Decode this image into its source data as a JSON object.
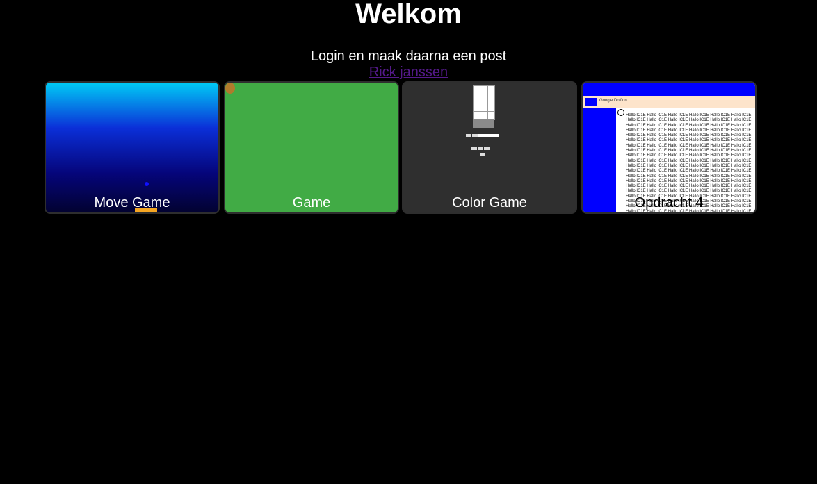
{
  "header": {
    "title": "Welkom",
    "subtitle": "Login en maak daarna een post",
    "author_link": "Rick janssen"
  },
  "cards": [
    {
      "label": "Move Game"
    },
    {
      "label": "Game"
    },
    {
      "label": "Color Game"
    },
    {
      "label": "Opdracht 4",
      "thumb_band": "Google Dolfion",
      "thumb_text": "Hallo IC1E Hallo IC1E Hallo IC1E Hallo IC1E Hallo IC1E Hallo IC1E Hallo IC1E Hallo IC1E Hallo IC1E Hallo IC1E Hallo IC1E Hallo IC1E Hallo IC1E Hallo IC1E Hallo IC1E Hallo IC1E Hallo IC1E Hallo IC1E Hallo IC1E Hallo IC1E Hallo IC1E Hallo IC1E Hallo IC1E Hallo IC1E Hallo IC1E Hallo IC1E Hallo IC1E Hallo IC1E Hallo IC1E Hallo IC1E Hallo IC1E Hallo IC1E Hallo IC1E Hallo IC1E Hallo IC1E Hallo IC1E Hallo IC1E Hallo IC1E Hallo IC1E Hallo IC1E Hallo IC1E Hallo IC1E Hallo IC1E Hallo IC1E Hallo IC1E Hallo IC1E Hallo IC1E Hallo IC1E Hallo IC1E Hallo IC1E Hallo IC1E Hallo IC1E Hallo IC1E Hallo IC1E Hallo IC1E Hallo IC1E Hallo IC1E Hallo IC1E Hallo IC1E Hallo IC1E Hallo IC1E Hallo IC1E Hallo IC1E Hallo IC1E Hallo IC1E Hallo IC1E Hallo IC1E Hallo IC1E Hallo IC1E Hallo IC1E Hallo IC1E Hallo IC1E Hallo IC1E Hallo IC1E Hallo IC1E Hallo IC1E Hallo IC1E Hallo IC1E Hallo IC1E Hallo IC1E Hallo IC1E Hallo IC1E Hallo IC1E Hallo IC1E Hallo IC1E Hallo IC1E Hallo IC1E Hallo IC1E Hallo IC1E Hallo IC1E Hallo IC1E Hallo IC1E Hallo IC1E Hallo IC1E Hallo IC1E Hallo IC1E Hallo IC1E Hallo IC1E Hallo IC1E Hallo IC1E Hallo IC1E Hallo IC1E Hallo IC1E Hallo IC1E Hallo IC1E Hallo IC1E Hallo IC1E Hallo IC1E Hallo IC1E Hallo IC1E Hallo IC1E Hallo IC1E Hallo IC1E Hallo IC1E Hallo IC1E Hallo IC1E Hallo IC1E Hallo IC1E Hallo IC1E Hallo IC1E Hallo IC1E Hallo IC1E Hallo IC1E Hallo IC1E Hallo IC1E Hallo IC1E Hallo IC1E Hallo IC1E Hallo IC1E Hallo IC1E"
    }
  ],
  "colors": {
    "background": "#000000",
    "link": "#551a8b",
    "game_green": "#41ab45",
    "card_border": "#2e2e2e",
    "accent_blue": "#0000ff",
    "paddle": "#f5a623"
  }
}
